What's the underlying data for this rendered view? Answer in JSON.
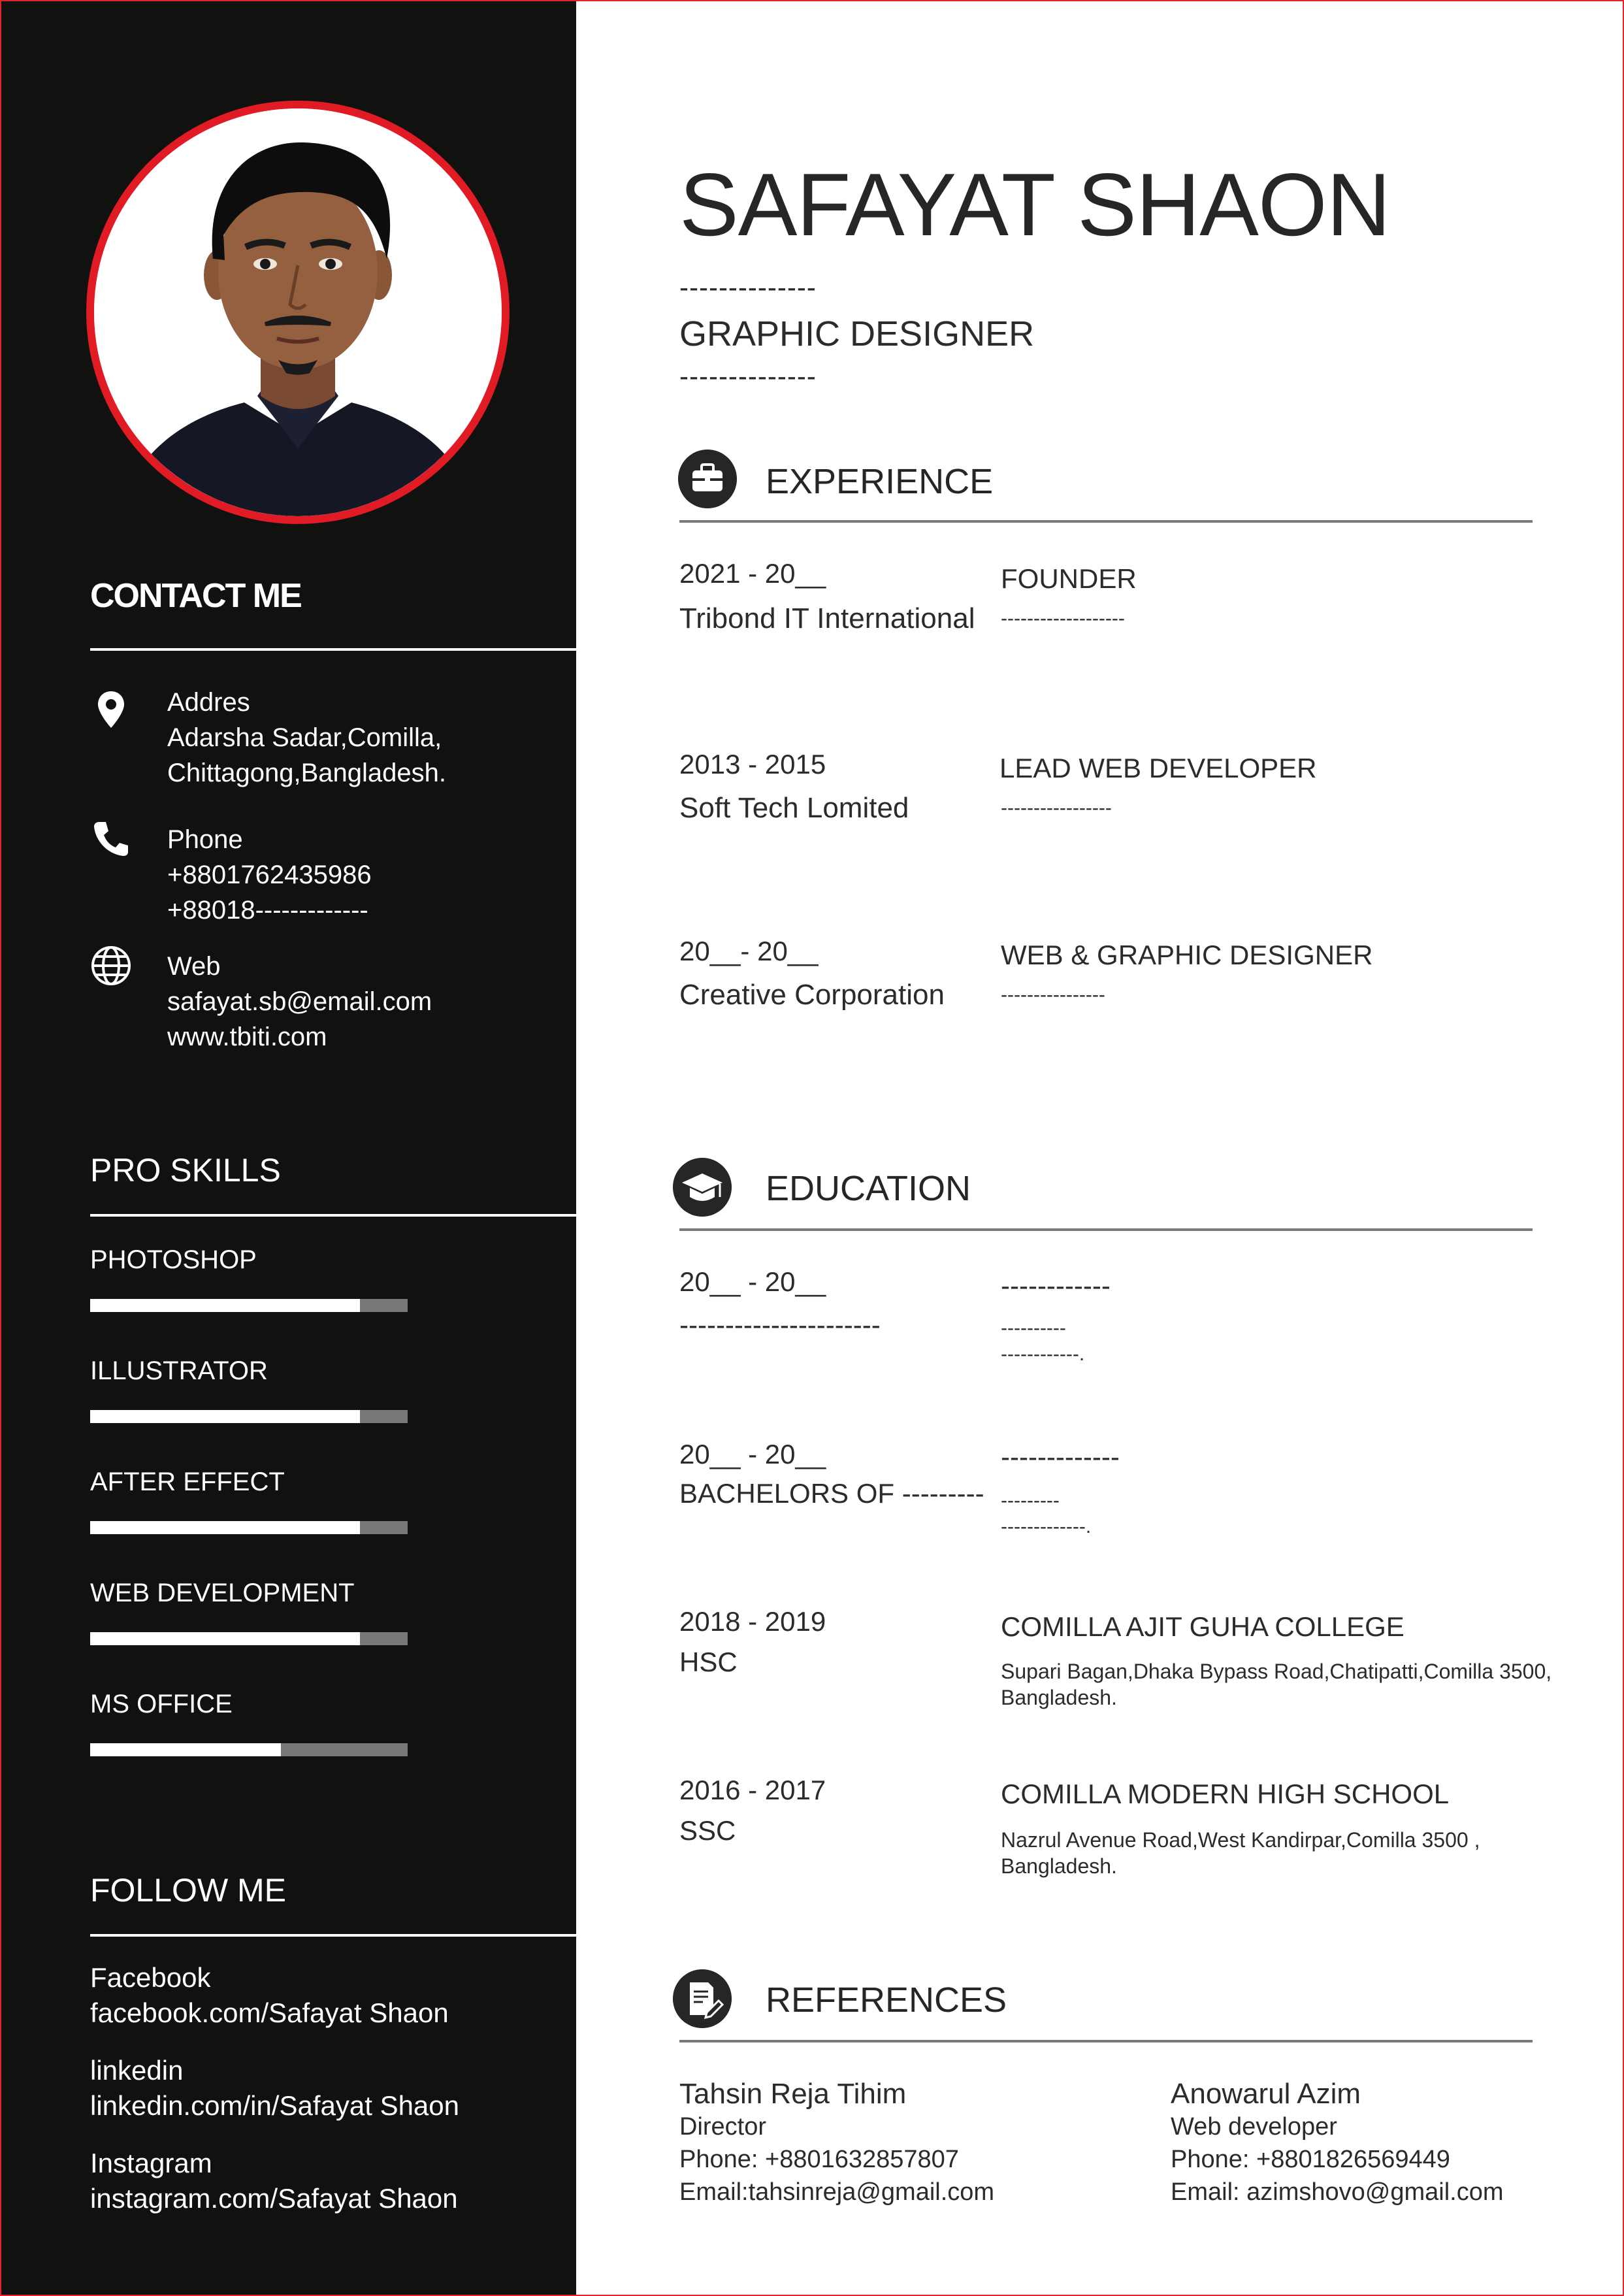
{
  "name": "SAFAYAT SHAON",
  "dash_line": "--------------",
  "role": "GRAPHIC DESIGNER",
  "contact": {
    "heading": "CONTACT ME",
    "address": {
      "label": "Addres",
      "line1": "Adarsha Sadar,Comilla,",
      "line2": "Chittagong,Bangladesh."
    },
    "phone": {
      "label": "Phone",
      "line1": "+8801762435986",
      "line2": "+88018-------------"
    },
    "web": {
      "label": "Web",
      "line1": "safayat.sb@email.com",
      "line2": "www.tbiti.com"
    }
  },
  "skills": {
    "heading": "PRO SKILLS",
    "items": [
      {
        "name": "PHOTOSHOP",
        "level": 0.85
      },
      {
        "name": "ILLUSTRATOR",
        "level": 0.85
      },
      {
        "name": "AFTER EFFECT",
        "level": 0.85
      },
      {
        "name": "WEB DEVELOPMENT",
        "level": 0.85
      },
      {
        "name": "MS OFFICE",
        "level": 0.6
      }
    ]
  },
  "follow": {
    "heading": "FOLLOW ME",
    "items": [
      {
        "label": "Facebook",
        "value": "facebook.com/Safayat Shaon"
      },
      {
        "label": "linkedin",
        "value": "linkedin.com/in/Safayat Shaon"
      },
      {
        "label": "Instagram",
        "value": "instagram.com/Safayat Shaon"
      }
    ]
  },
  "experience": {
    "heading": "EXPERIENCE",
    "items": [
      {
        "period": "2021 - 20__",
        "org": "Tribond IT International",
        "title": "FOUNDER",
        "note": "-------------------"
      },
      {
        "period": "2013 - 2015",
        "org": "Soft Tech Lomited",
        "title": "LEAD WEB DEVELOPER",
        "note": "-----------------"
      },
      {
        "period": "20__- 20__",
        "org": "Creative Corporation",
        "title": "WEB & GRAPHIC DESIGNER",
        "note": "----------------"
      }
    ]
  },
  "education": {
    "heading": "EDUCATION",
    "items": [
      {
        "period": "20__ - 20__",
        "degree": "----------------------",
        "school": "------------",
        "detail1": "----------",
        "detail2": "------------."
      },
      {
        "period": "20__ - 20__",
        "degree": "BACHELORS OF ---------",
        "school": "-------------",
        "detail1": "---------",
        "detail2": "-------------."
      },
      {
        "period": "2018 - 2019",
        "degree": "HSC",
        "school": "COMILLA AJIT GUHA COLLEGE",
        "detail1": "Supari Bagan,Dhaka Bypass Road,Chatipatti,Comilla 3500,",
        "detail2": "Bangladesh."
      },
      {
        "period": "2016 - 2017",
        "degree": "SSC",
        "school": "COMILLA MODERN HIGH SCHOOL",
        "detail1": "Nazrul Avenue Road,West Kandirpar,Comilla 3500 ,",
        "detail2": "Bangladesh."
      }
    ]
  },
  "references": {
    "heading": "REFERENCES",
    "items": [
      {
        "name": "Tahsin Reja Tihim",
        "position": "Director",
        "phone": "Phone: +8801632857807",
        "email": "Email:tahsinreja@gmail.com"
      },
      {
        "name": "Anowarul Azim",
        "position": "Web developer",
        "phone": "Phone: +8801826569449",
        "email": "Email: azimshovo@gmail.com"
      }
    ]
  },
  "colors": {
    "accent": "#e01b24",
    "sidebar": "#111110",
    "text": "#2b2b2b"
  }
}
